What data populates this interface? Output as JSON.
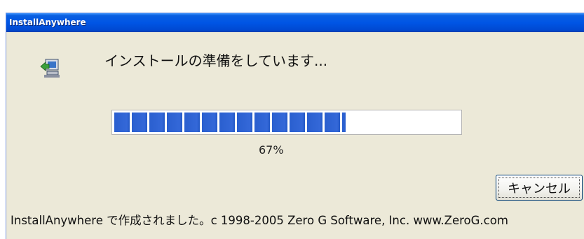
{
  "window": {
    "title": "InstallAnywhere"
  },
  "status": {
    "message": "インストールの準備をしています...",
    "icon": "computer-install-icon"
  },
  "progress": {
    "value": 0.67,
    "label": "67%",
    "accent_color": "#2a5fcf"
  },
  "buttons": {
    "cancel_label": "キャンセル"
  },
  "footer": {
    "credit": "InstallAnywhere で作成されました。c 1998-2005 Zero G Software, Inc.  www.ZeroG.com"
  },
  "colors": {
    "titlebar": "#0055e5",
    "window_bg": "#ece9d8"
  }
}
